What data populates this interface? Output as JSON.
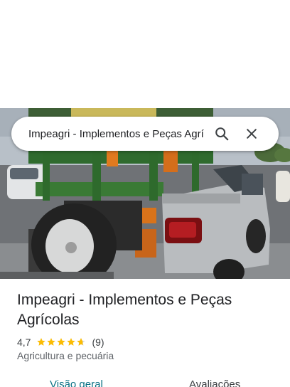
{
  "search": {
    "query": "Impeagri - Implementos e Peças Agrí",
    "search_icon": "search-icon",
    "close_icon": "close-icon"
  },
  "place": {
    "name": "Impeagri - Implementos e Peças Agrícolas",
    "rating": "4,7",
    "stars": 4.7,
    "review_count": "(9)",
    "category": "Agricultura e pecuária"
  },
  "tabs": [
    {
      "label": "Visão geral",
      "active": true
    },
    {
      "label": "Avaliações",
      "active": false
    }
  ],
  "colors": {
    "star": "#fbbc04",
    "active_tab": "#0b7285",
    "text": "#202124"
  }
}
